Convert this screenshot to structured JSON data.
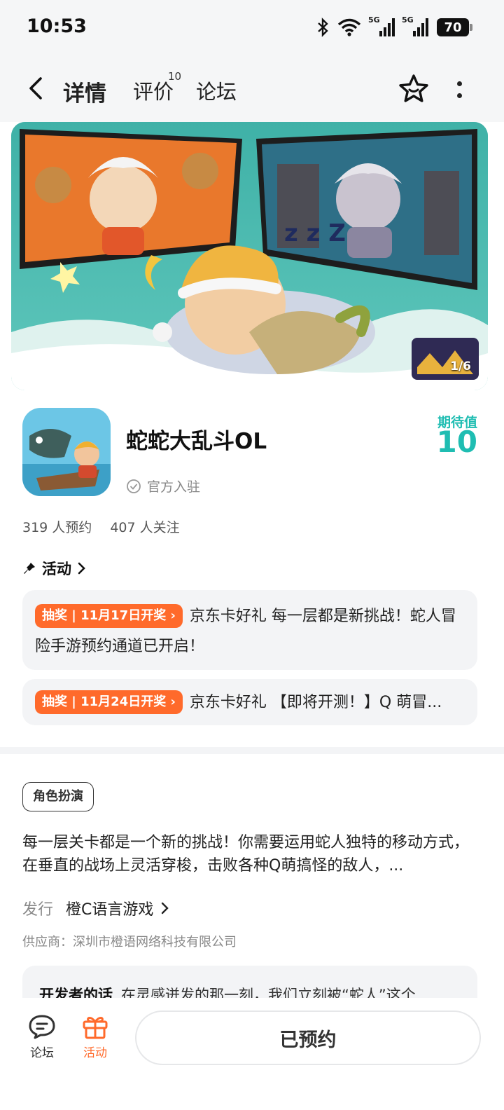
{
  "status_bar": {
    "time": "10:53",
    "battery": "70",
    "network1": "5G",
    "network2": "5G"
  },
  "nav": {
    "tabs": [
      {
        "label": "详情",
        "active": true
      },
      {
        "label": "评价",
        "badge": "10"
      },
      {
        "label": "论坛"
      }
    ]
  },
  "banner": {
    "counter": "1/6"
  },
  "game": {
    "title": "蛇蛇大乱斗OL",
    "official": "官方入驻",
    "expect_label": "期待值",
    "expect_value": "10",
    "reservations": "319 人预约",
    "follows": "407 人关注"
  },
  "activity": {
    "heading": "活动",
    "items": [
      {
        "tag": "抽奖 | 11月17日开奖",
        "text": "京东卡好礼 每一层都是新挑战！蛇人冒险手游预约通道已开启！"
      },
      {
        "tag": "抽奖 | 11月24日开奖",
        "text": "京东卡好礼 【即将开测！】Q 萌冒..."
      }
    ]
  },
  "details": {
    "genre": "角色扮演",
    "description": "每一层关卡都是一个新的挑战！你需要运用蛇人独特的移动方式，在垂直的战场上灵活穿梭，击败各种Q萌搞怪的敌人，...",
    "publisher_label": "发行",
    "publisher": "橙C语言游戏",
    "supplier": "供应商：深圳市橙语网络科技有限公司",
    "dev_title": "开发者的话",
    "dev_text": "在灵感迸发的那一刻，我们立刻被“蛇人”这个"
  },
  "bottom_bar": {
    "forum_label": "论坛",
    "activity_label": "活动",
    "reserve_label": "已预约"
  },
  "colors": {
    "accent": "#1fbdb2",
    "orange": "#ff6a2b"
  }
}
